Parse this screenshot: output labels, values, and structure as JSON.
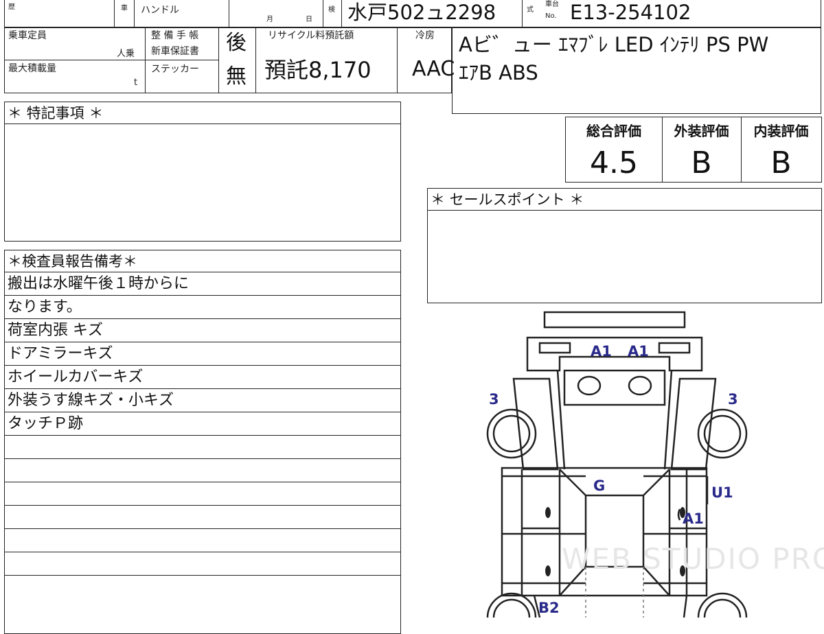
{
  "header": {
    "history_label": "歴",
    "car_label": "車",
    "handle_label": "ハンドル",
    "month_label": "月",
    "day_label": "日",
    "inspection_label": "検",
    "plate": "水戸502ュ2298",
    "model_label": "式",
    "chassis_label_top": "車台",
    "chassis_label_no": "No.",
    "chassis_number": "E13-254102"
  },
  "row2": {
    "capacity_label": "乗車定員",
    "capacity_unit": "人乗",
    "max_load_label": "最大積載量",
    "max_load_unit": "t",
    "maintenance_label": "整 備 手 帳",
    "warranty_label": "新車保証書",
    "warranty_value": "後",
    "sticker_label": "ステッカー",
    "sticker_value": "無",
    "recycle_label": "リサイクル料預託額",
    "recycle_value": "預託8,170",
    "ac_label": "冷房",
    "ac_value": "AAC",
    "equipment_line1": "Aビ゛ュー ｴﾏﾌﾞﾚ LED ｲﾝﾃﾘ PS PW",
    "equipment_line2": "ｴｱB ABS"
  },
  "special_notes": {
    "title": "＊ 特記事項 ＊"
  },
  "grades": {
    "overall_label": "総合評価",
    "overall_value": "4.5",
    "exterior_label": "外装評価",
    "exterior_value": "B",
    "interior_label": "内装評価",
    "interior_value": "B"
  },
  "sales_point": {
    "title": "＊ セールスポイント ＊"
  },
  "inspector": {
    "title": "＊検査員報告備考＊",
    "lines": [
      "搬出は水曜午後１時からに",
      "なります。",
      "荷室内張 キズ",
      "ドアミラーキズ",
      "ホイールカバーキズ",
      "外装うす線キズ・小キズ",
      "タッチＰ跡",
      "",
      "",
      "",
      "",
      "",
      ""
    ]
  },
  "diagram": {
    "marks": [
      "A1",
      "A1",
      "3",
      "3",
      "G",
      "U1",
      "A1",
      "B2"
    ],
    "color": "#2a2a8a"
  },
  "watermark": "WEB STUDIO PRO"
}
